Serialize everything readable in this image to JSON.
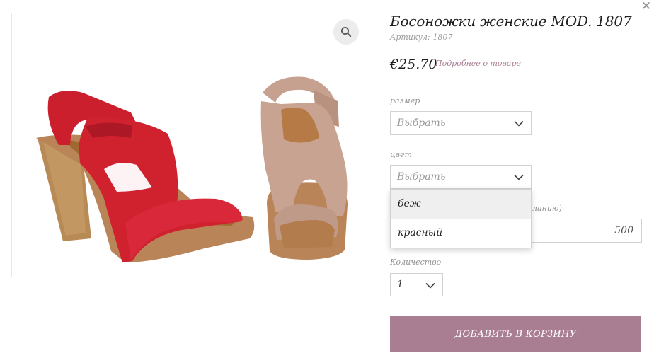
{
  "product": {
    "title": "Босоножки женские MOD. 1807",
    "sku_label": "Артикул:",
    "sku_value": "1807",
    "price": "€25.70",
    "details_link": "Подробнее о товаре"
  },
  "options": {
    "size": {
      "label": "размер",
      "selected": "Выбрать"
    },
    "color": {
      "label": "цвет",
      "selected": "Выбрать",
      "options": [
        "беж",
        "красный"
      ],
      "highlighted": "беж"
    },
    "extra": {
      "partial_label": "желанию)",
      "value": "500"
    },
    "quantity": {
      "label": "Количество",
      "value": "1"
    }
  },
  "actions": {
    "add_to_cart": "ДОБАВИТЬ В КОРЗИНУ"
  },
  "icons": {
    "close": "close-icon",
    "zoom": "search-icon",
    "chevron": "chevron-down-icon"
  },
  "colors": {
    "accent": "#a97d92",
    "link": "#a87c92",
    "border": "#d2d2d2",
    "shoe_red": "#d0212f",
    "shoe_beige": "#c6a18f",
    "cork": "#b98458",
    "wood_heel": "#b88a55"
  }
}
